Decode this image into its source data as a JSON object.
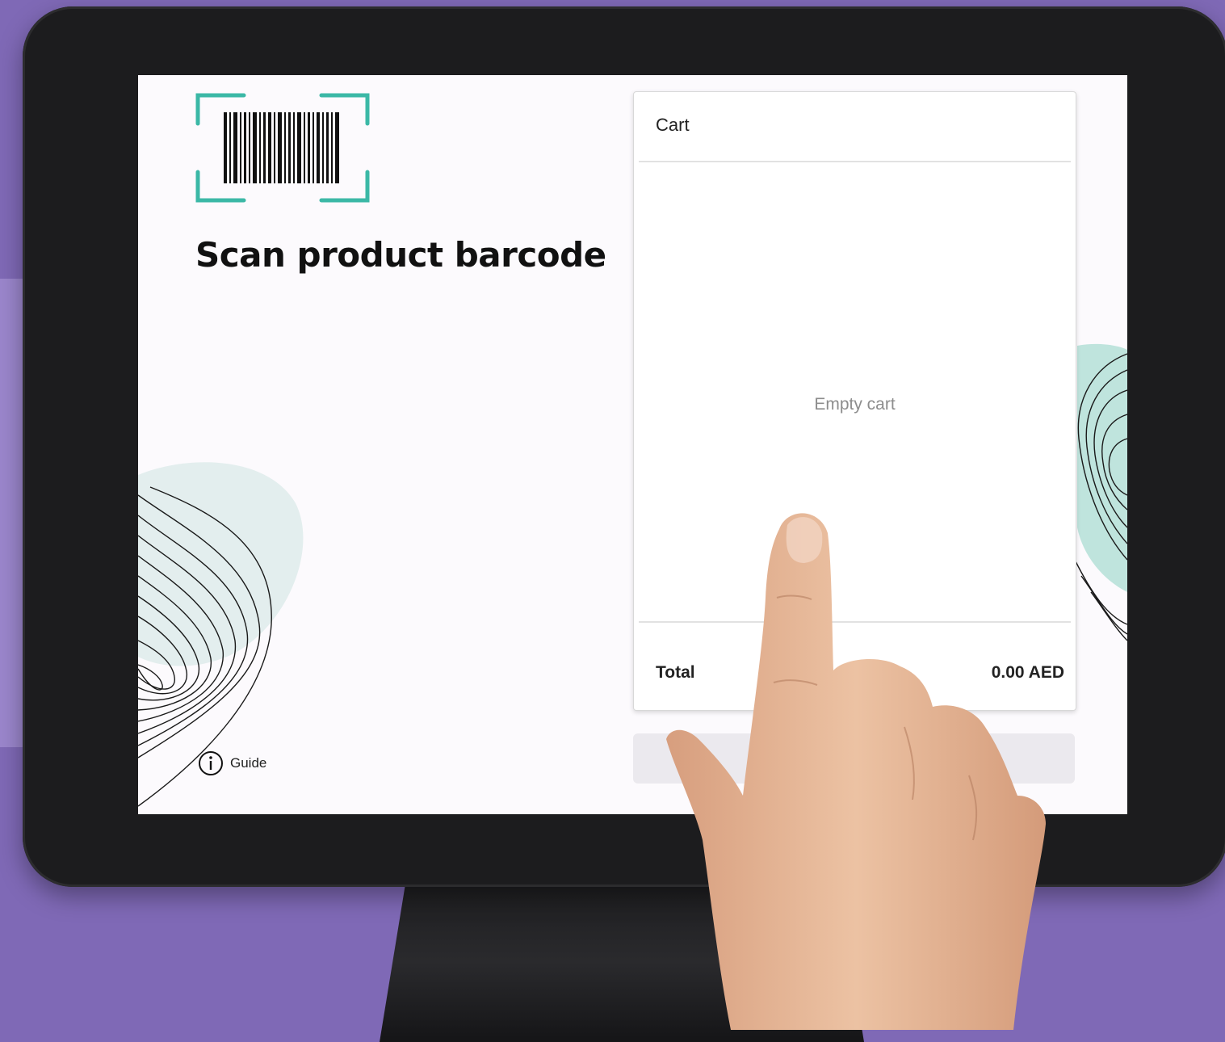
{
  "kiosk": {
    "scan_title": "Scan product barcode",
    "guide_label": "Guide",
    "cart": {
      "title": "Cart",
      "empty_message": "Empty cart",
      "total_label": "Total",
      "total_value": "0.00 AED"
    }
  },
  "icons": {
    "barcode": "barcode-scan-icon",
    "info": "info-icon"
  },
  "colors": {
    "scan_frame_accent": "#3bb8a6",
    "background": "#7f69b6",
    "screen": "#fcfafd"
  }
}
